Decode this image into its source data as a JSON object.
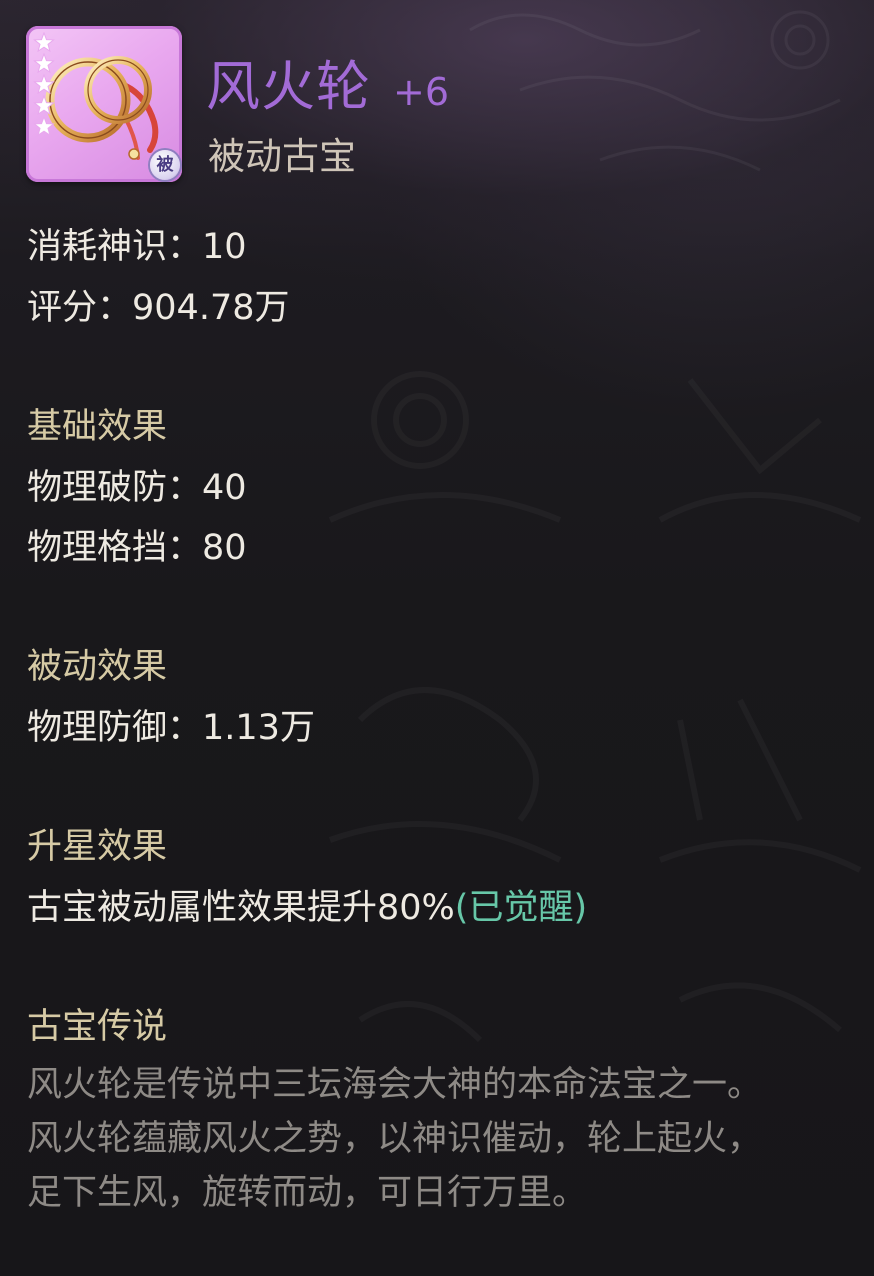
{
  "item": {
    "name": "风火轮",
    "level": "+6",
    "type": "被动古宝",
    "badge": "被",
    "star_count": 5,
    "icon": "wind-fire-wheels-icon"
  },
  "stats": {
    "consume_label": "消耗神识：",
    "consume_value": "10",
    "score_label": "评分：",
    "score_value": "904.78万"
  },
  "basic_effect": {
    "title": "基础效果",
    "lines": [
      {
        "label": "物理破防：",
        "value": "40"
      },
      {
        "label": "物理格挡：",
        "value": "80"
      }
    ]
  },
  "passive_effect": {
    "title": "被动效果",
    "lines": [
      {
        "label": "物理防御：",
        "value": "1.13万"
      }
    ]
  },
  "star_effect": {
    "title": "升星效果",
    "text": "古宝被动属性效果提升80%",
    "status": "(已觉醒)"
  },
  "legend": {
    "title": "古宝传说",
    "lines": [
      "风火轮是传说中三坛海会大神的本命法宝之一。",
      "风火轮蕴藏风火之势，以神识催动，轮上起火，",
      "足下生风，旋转而动，可日行万里。"
    ]
  },
  "colors": {
    "name": "#a26bd6",
    "section_title": "#d6caa5",
    "body_text": "#eeeae2",
    "awakened": "#67c7a8",
    "lore_text": "#8e8a86",
    "icon_frame": "#e9a8ef"
  }
}
